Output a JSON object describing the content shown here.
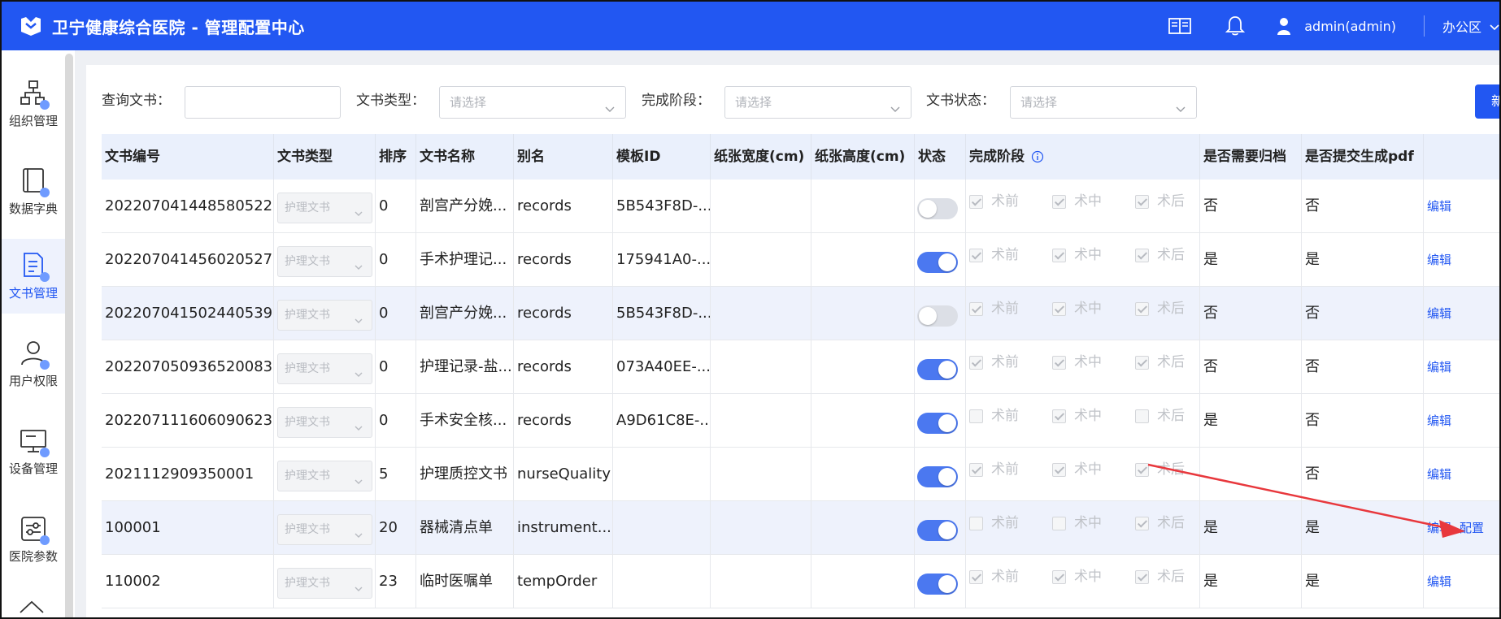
{
  "header": {
    "title": "卫宁健康综合医院 - 管理配置中心",
    "user": "admin(admin)",
    "zone": "办公区",
    "brand_color": "#2257f2",
    "icons": [
      "book-icon",
      "bell-icon",
      "user-icon",
      "chevron-down-icon"
    ]
  },
  "sidebar": {
    "items": [
      {
        "label": "组织管理",
        "icon": "org-chart-icon"
      },
      {
        "label": "数据字典",
        "icon": "dictionary-icon"
      },
      {
        "label": "文书管理",
        "icon": "document-icon",
        "active": true
      },
      {
        "label": "用户权限",
        "icon": "user-permission-icon"
      },
      {
        "label": "设备管理",
        "icon": "monitor-icon"
      },
      {
        "label": "医院参数",
        "icon": "settings-panel-icon"
      }
    ]
  },
  "filters": {
    "query_label": "查询文书：",
    "query_value": "",
    "type_label": "文书类型：",
    "type_placeholder": "请选择",
    "stage_label": "完成阶段：",
    "stage_placeholder": "请选择",
    "status_label": "文书状态：",
    "status_placeholder": "请选择",
    "new_button": "新"
  },
  "table": {
    "columns": [
      "文书编号",
      "文书类型",
      "排序",
      "文书名称",
      "别名",
      "模板ID",
      "纸张宽度(cm)",
      "纸张高度(cm)",
      "状态",
      "完成阶段",
      "是否需要归档",
      "是否提交生成pdf",
      ""
    ],
    "stage_labels": [
      "术前",
      "术中",
      "术后"
    ],
    "edit_label": "编辑",
    "config_label": "配置",
    "rows": [
      {
        "id": "202207041448580522",
        "type": "护理文书",
        "order": "0",
        "name": "剖宫产分娩...",
        "alias": "records",
        "template": "5B543F8D-...",
        "width": "",
        "height": "",
        "status_on": false,
        "stages": [
          true,
          true,
          true
        ],
        "archive": "否",
        "pdf": "否",
        "config": false,
        "alt": false
      },
      {
        "id": "202207041456020527",
        "type": "护理文书",
        "order": "0",
        "name": "手术护理记...",
        "alias": "records",
        "template": "175941A0-...",
        "width": "",
        "height": "",
        "status_on": true,
        "stages": [
          true,
          true,
          true
        ],
        "archive": "是",
        "pdf": "是",
        "config": false,
        "alt": false
      },
      {
        "id": "202207041502440539",
        "type": "护理文书",
        "order": "0",
        "name": "剖宫产分娩...",
        "alias": "records",
        "template": "5B543F8D-...",
        "width": "",
        "height": "",
        "status_on": false,
        "stages": [
          true,
          true,
          true
        ],
        "archive": "否",
        "pdf": "否",
        "config": false,
        "alt": true
      },
      {
        "id": "202207050936520083",
        "type": "护理文书",
        "order": "0",
        "name": "护理记录-盐...",
        "alias": "records",
        "template": "073A40EE-...",
        "width": "",
        "height": "",
        "status_on": true,
        "stages": [
          true,
          true,
          true
        ],
        "archive": "否",
        "pdf": "否",
        "config": false,
        "alt": false
      },
      {
        "id": "202207111606090623",
        "type": "护理文书",
        "order": "0",
        "name": "手术安全核...",
        "alias": "records",
        "template": "A9D61C8E-...",
        "width": "",
        "height": "",
        "status_on": true,
        "stages": [
          false,
          true,
          false
        ],
        "archive": "是",
        "pdf": "否",
        "config": false,
        "alt": false
      },
      {
        "id": "2021112909350001",
        "type": "护理文书",
        "order": "5",
        "name": "护理质控文书",
        "alias": "nurseQuality",
        "template": "",
        "width": "",
        "height": "",
        "status_on": true,
        "stages": [
          true,
          true,
          true
        ],
        "archive": "",
        "pdf": "否",
        "config": false,
        "alt": false
      },
      {
        "id": "100001",
        "type": "护理文书",
        "order": "20",
        "name": "器械清点单",
        "alias": "instrument...",
        "template": "",
        "width": "",
        "height": "",
        "status_on": true,
        "stages": [
          false,
          false,
          true
        ],
        "archive": "是",
        "pdf": "是",
        "config": true,
        "alt": true
      },
      {
        "id": "110002",
        "type": "护理文书",
        "order": "23",
        "name": "临时医嘱单",
        "alias": "tempOrder",
        "template": "",
        "width": "",
        "height": "",
        "status_on": true,
        "stages": [
          true,
          true,
          true
        ],
        "archive": "是",
        "pdf": "是",
        "config": false,
        "alt": false
      }
    ]
  },
  "annotation": {
    "arrow_color": "#e8383d"
  }
}
